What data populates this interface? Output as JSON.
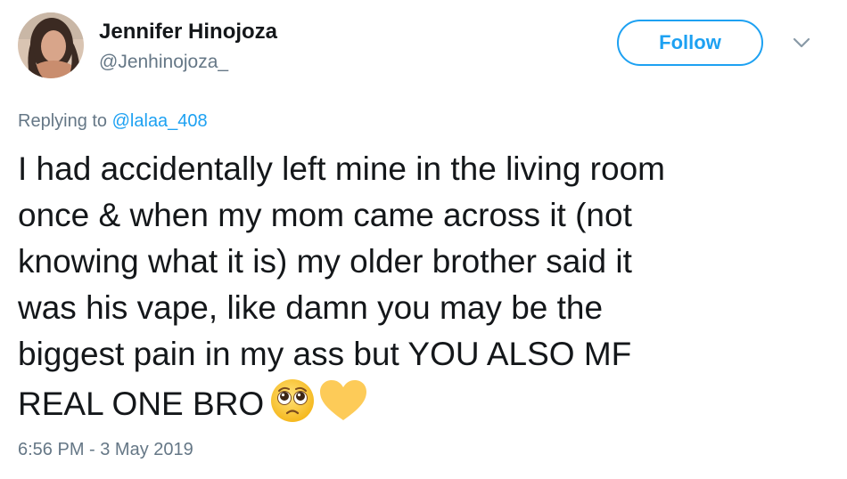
{
  "author": {
    "display_name": "Jennifer Hinojoza",
    "handle": "@Jenhinojoza_"
  },
  "follow_button": {
    "label": "Follow"
  },
  "reply": {
    "prefix": "Replying to ",
    "to_handle": "@lalaa_408"
  },
  "tweet": {
    "lines": [
      "I had accidentally left mine in the living room",
      "once & when my mom came across it (not",
      "knowing what it is) my older brother said it",
      "was his vape, like damn you may be the",
      "biggest pain in my ass but YOU ALSO MF",
      "REAL ONE BRO"
    ],
    "emojis": [
      "pleading-face-icon",
      "yellow-heart-icon"
    ]
  },
  "timestamp": "6:56 PM - 3 May 2019",
  "colors": {
    "accent": "#1da1f2",
    "text": "#14171a",
    "secondary_text": "#657786"
  }
}
